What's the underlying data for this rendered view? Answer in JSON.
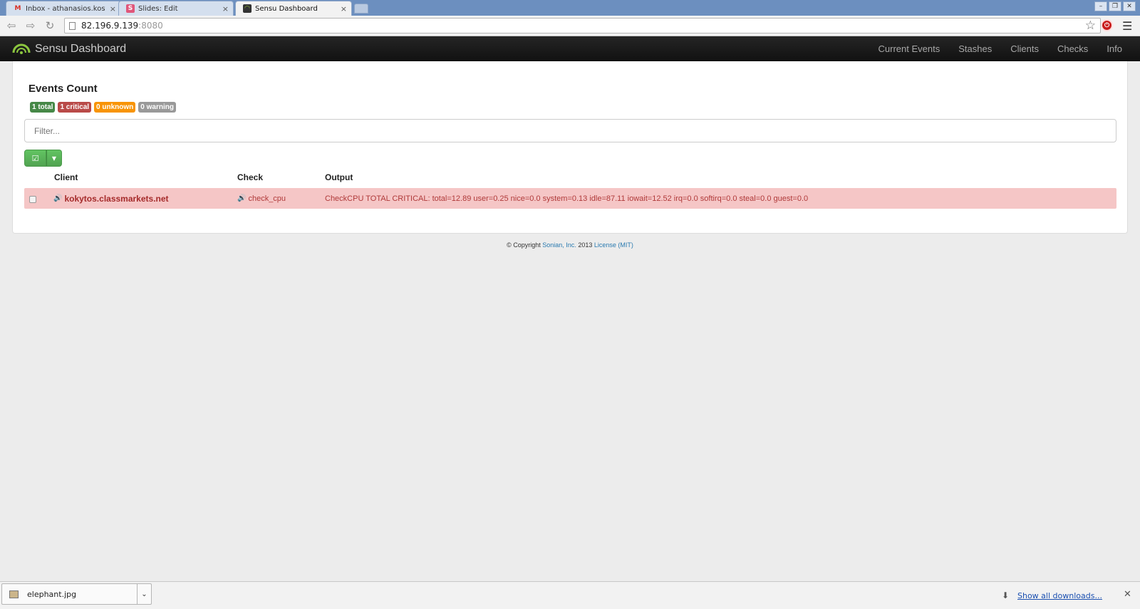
{
  "browser": {
    "tabs": [
      {
        "title": "Inbox - athanasios.kostop",
        "icon": "gmail-icon"
      },
      {
        "title": "Slides: Edit",
        "icon": "slides-icon"
      },
      {
        "title": "Sensu Dashboard",
        "icon": "sensu-icon"
      }
    ],
    "url_host": "82.196.9.139",
    "url_port": ":8080"
  },
  "app": {
    "brand": "Sensu Dashboard",
    "nav": [
      "Current Events",
      "Stashes",
      "Clients",
      "Checks",
      "Info"
    ]
  },
  "events": {
    "title": "Events Count",
    "badges": [
      {
        "label": "1 total",
        "color": "#468847"
      },
      {
        "label": "1 critical",
        "color": "#b94a48"
      },
      {
        "label": "0 unknown",
        "color": "#f89406"
      },
      {
        "label": "0 warning",
        "color": "#999999"
      }
    ],
    "filter_placeholder": "Filter...",
    "columns": [
      "Client",
      "Check",
      "Output"
    ],
    "rows": [
      {
        "client": "kokytos.classmarkets.net",
        "check": "check_cpu",
        "output": "CheckCPU TOTAL CRITICAL: total=12.89 user=0.25 nice=0.0 system=0.13 idle=87.11 iowait=12.52 irq=0.0 softirq=0.0 steal=0.0 guest=0.0"
      }
    ]
  },
  "footer": {
    "copyright": "© Copyright",
    "company": "Sonian, Inc.",
    "year": "2013",
    "license": "License (MIT)"
  },
  "downloads": {
    "file": "elephant.jpg",
    "show_all": "Show all downloads..."
  }
}
